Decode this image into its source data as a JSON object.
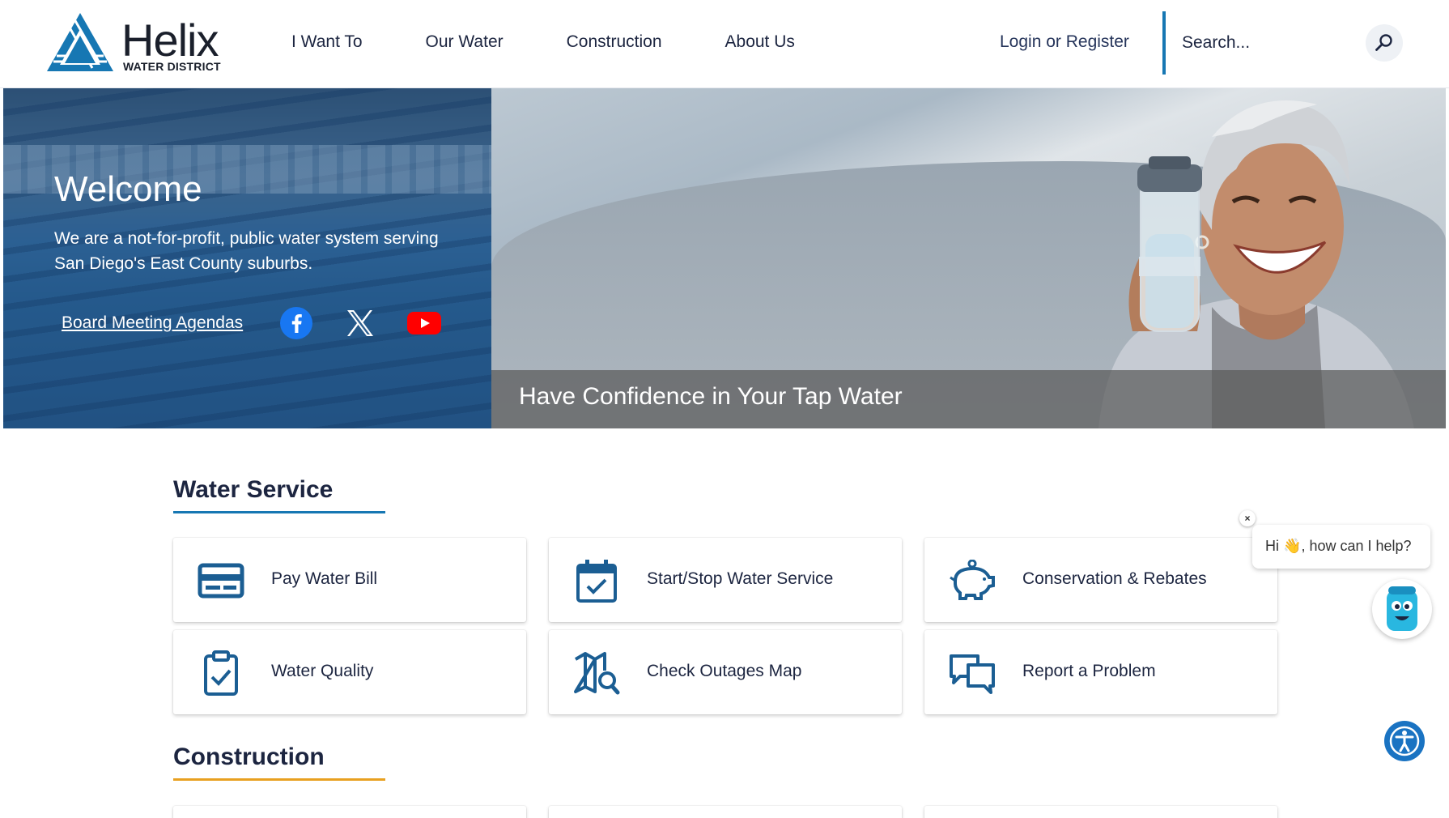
{
  "brand": {
    "name": "Helix",
    "subtitle": "WATER DISTRICT",
    "color": "#1677b3"
  },
  "nav": {
    "items": [
      "I Want To",
      "Our Water",
      "Construction",
      "About Us"
    ]
  },
  "header": {
    "login_label": "Login or Register",
    "search_placeholder": "Search..."
  },
  "hero": {
    "title": "Welcome",
    "description": "We are a not-for-profit, public water system serving San Diego's East County suburbs.",
    "board_link": "Board Meeting Agendas",
    "caption": "Have Confidence in Your Tap Water",
    "social_icons": [
      "facebook-icon",
      "x-icon",
      "youtube-icon"
    ]
  },
  "water_service": {
    "title": "Water Service",
    "rule_color": "#1677b3",
    "cards": [
      {
        "label": "Pay Water Bill",
        "icon": "credit-card-icon"
      },
      {
        "label": "Start/Stop Water Service",
        "icon": "calendar-check-icon"
      },
      {
        "label": "Conservation & Rebates",
        "icon": "piggy-bank-icon"
      },
      {
        "label": "Water Quality",
        "icon": "clipboard-check-icon"
      },
      {
        "label": "Check Outages Map",
        "icon": "map-search-icon"
      },
      {
        "label": "Report a Problem",
        "icon": "chat-bubbles-icon"
      }
    ]
  },
  "construction": {
    "title": "Construction",
    "rule_color": "#e8a020"
  },
  "chat": {
    "greeting_prefix": "Hi",
    "greeting_suffix": ", how can I help?",
    "close_label": "×"
  }
}
